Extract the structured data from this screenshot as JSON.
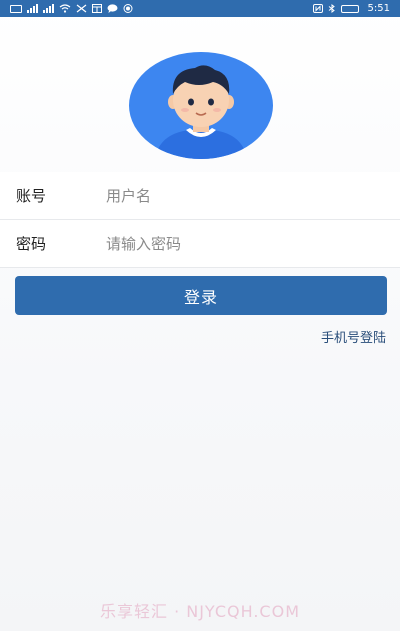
{
  "status_bar": {
    "time": "5:51",
    "battery_level": 0.9
  },
  "form": {
    "account_label": "账号",
    "account_placeholder": "用户名",
    "password_label": "密码",
    "password_placeholder": "请输入密码"
  },
  "actions": {
    "login_label": "登录",
    "phone_login_label": "手机号登陆"
  },
  "watermark": "乐享轻汇 · NJYCQH.COM",
  "colors": {
    "primary": "#2f6cae",
    "avatar_bg": "#3d86f0"
  },
  "icons": {
    "avatar": "user-avatar-icon"
  }
}
